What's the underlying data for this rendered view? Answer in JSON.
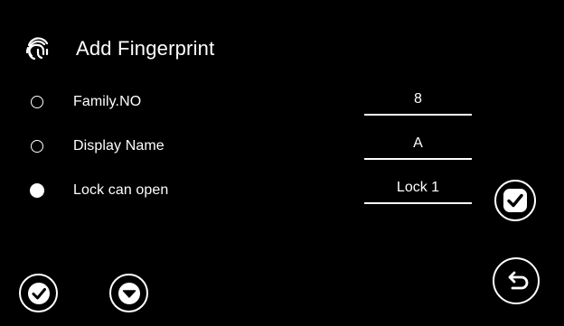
{
  "header": {
    "title": "Add Fingerprint",
    "icon": "fingerprint-icon"
  },
  "rows": [
    {
      "label": "Family.NO",
      "value": "8",
      "selected": false
    },
    {
      "label": "Display Name",
      "value": "A",
      "selected": false
    },
    {
      "label": "Lock can open",
      "value": "Lock 1",
      "selected": true
    }
  ],
  "buttons": {
    "confirm": "check-icon",
    "bottom_check": "check-icon",
    "bottom_down": "chevron-down-icon",
    "back": "return-icon"
  },
  "colors": {
    "background": "#000000",
    "foreground": "#ffffff"
  }
}
